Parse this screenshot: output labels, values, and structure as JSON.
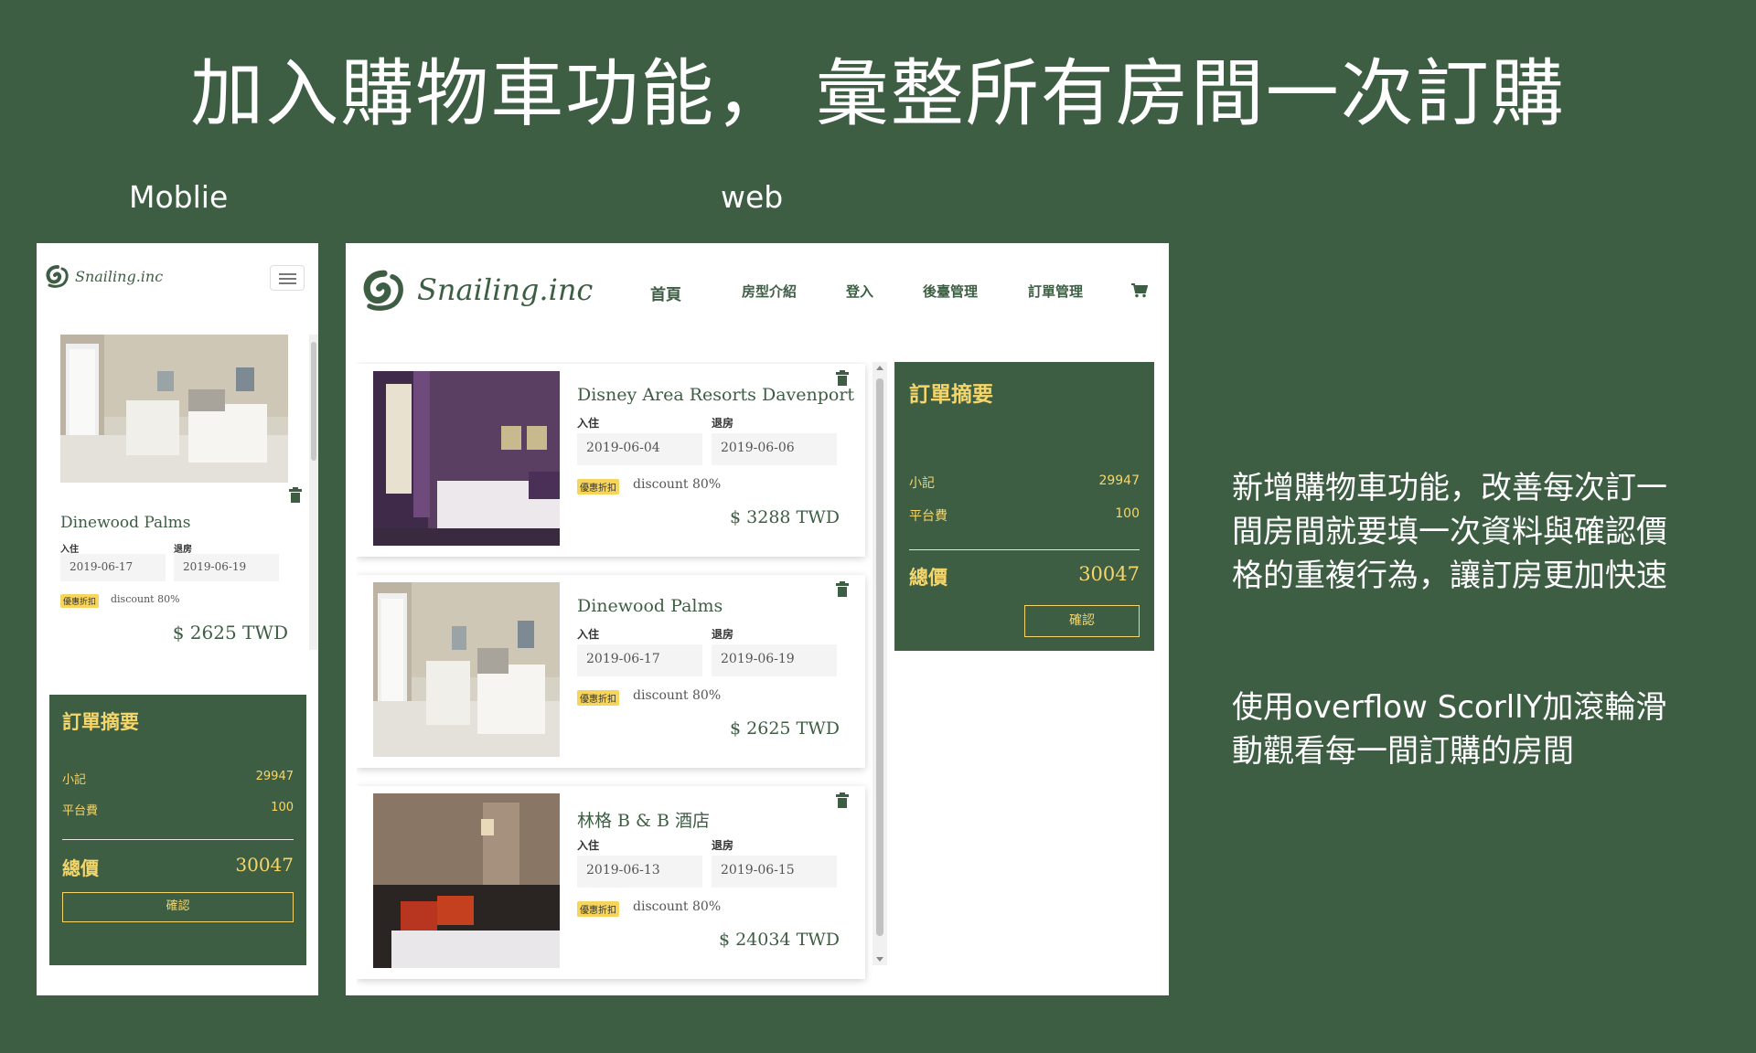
{
  "slide": {
    "title": "加入購物車功能， 彙整所有房間一次訂購",
    "mobile_label": "Moblie",
    "web_label": "web",
    "description_1": "新增購物車功能，改善每次訂一間房間就要填一次資料與確認價格的重複行為，讓訂房更加快速",
    "description_2": "使用overflow ScorllY加滾輪滑動觀看每一間訂購的房間"
  },
  "brand": {
    "name": "Snailing.inc"
  },
  "nav": {
    "items": [
      "首頁",
      "房型介紹",
      "登入",
      "後臺管理",
      "訂單管理"
    ],
    "cart_icon": "cart-icon"
  },
  "labels": {
    "checkin": "入住",
    "checkout": "退房",
    "badge": "優惠折扣",
    "discount": "discount 80%"
  },
  "rooms": [
    {
      "name": "Disney Area Resorts Davenport",
      "checkin": "2019-06-04",
      "checkout": "2019-06-06",
      "price": "$ 3288 TWD"
    },
    {
      "name": "Dinewood Palms",
      "checkin": "2019-06-17",
      "checkout": "2019-06-19",
      "price": "$ 2625 TWD"
    },
    {
      "name": "林格 B & B 酒店",
      "checkin": "2019-06-13",
      "checkout": "2019-06-15",
      "price": "$ 24034 TWD"
    }
  ],
  "summary": {
    "title": "訂單摘要",
    "subtotal_label": "小記",
    "subtotal": "29947",
    "fee_label": "平台費",
    "fee": "100",
    "total_label": "總價",
    "total": "30047",
    "confirm_label": "確認"
  },
  "colors": {
    "background": "#3e5e44",
    "accent": "#f5d66b",
    "badge": "#f7d55a",
    "panel": "#ffffff"
  }
}
